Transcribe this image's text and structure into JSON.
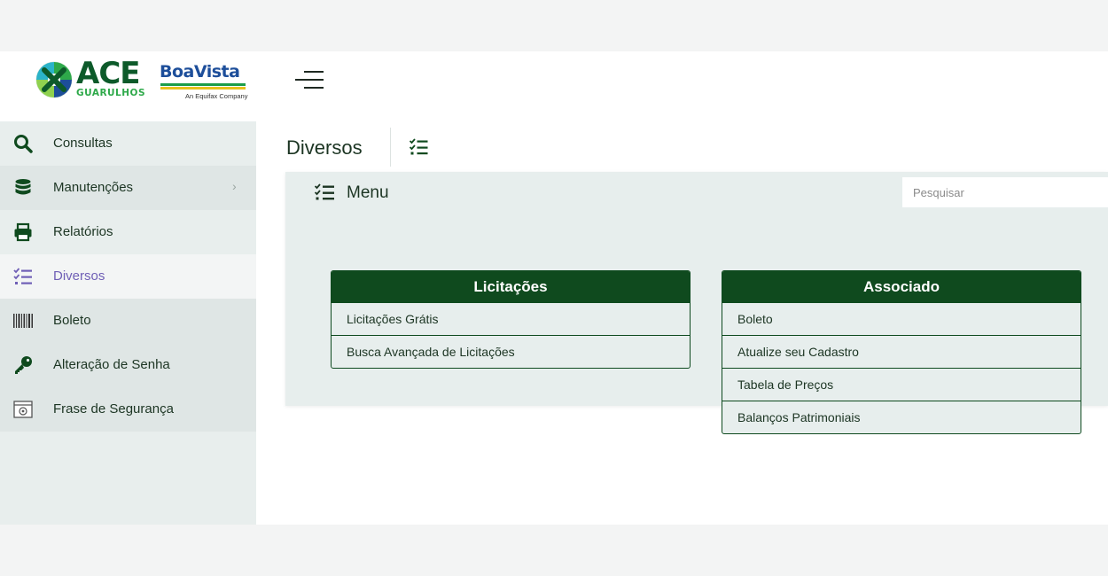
{
  "brand": {
    "ace_name": "ACE",
    "ace_subtitle": "GUARULHOS",
    "partner_name": "BoaVista",
    "partner_tagline": "An Equifax Company"
  },
  "sidebar": {
    "items": [
      {
        "label": "Consultas",
        "icon": "search-icon"
      },
      {
        "label": "Manutenções",
        "icon": "database-icon",
        "chevron": "›"
      },
      {
        "label": "Relatórios",
        "icon": "printer-icon"
      },
      {
        "label": "Diversos",
        "icon": "checklist-icon",
        "active": true
      },
      {
        "label": "Boleto",
        "icon": "barcode-icon"
      },
      {
        "label": "Alteração de Senha",
        "icon": "key-icon"
      },
      {
        "label": "Frase de Segurança",
        "icon": "security-phrase-icon"
      }
    ]
  },
  "main": {
    "title": "Diversos",
    "menu_label": "Menu",
    "search": {
      "placeholder": "Pesquisar",
      "value": ""
    },
    "cards": [
      {
        "title": "Licitações",
        "items": [
          "Licitações Grátis",
          "Busca Avançada de Licitações"
        ]
      },
      {
        "title": "Associado",
        "items": [
          "Boleto",
          "Atualize seu Cadastro",
          "Tabela de Preços",
          "Balanços Patrimoniais"
        ]
      }
    ]
  },
  "colors": {
    "primary_green": "#0f4a1e",
    "sidebar_bg": "#e8eeed",
    "active_text": "#6f5fb6",
    "panel_bg": "#e7eeed"
  }
}
